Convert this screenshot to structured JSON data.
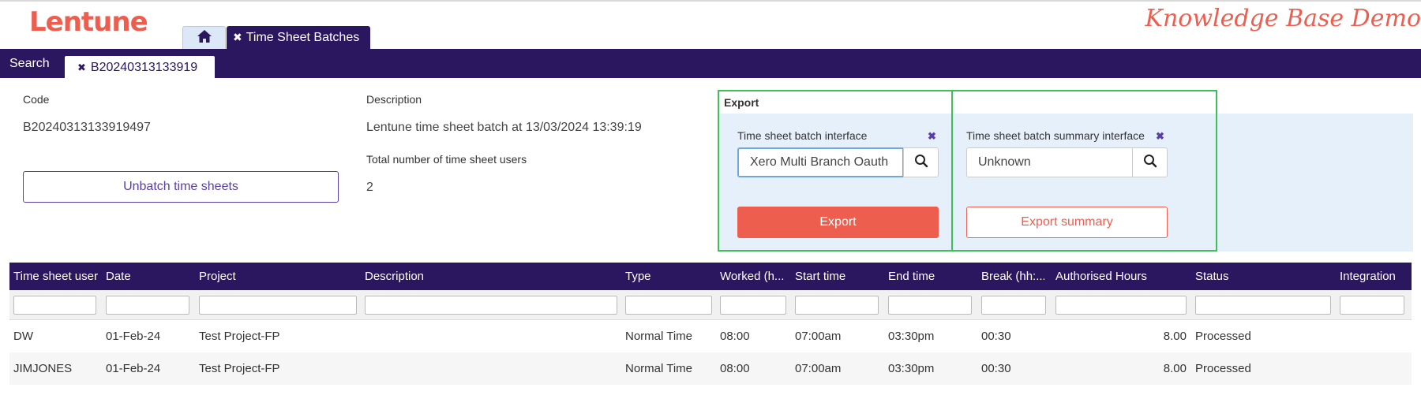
{
  "brand": {
    "logo": "Lentune",
    "right_title": "Knowledge Base Demo"
  },
  "tabs": {
    "batches_label": "Time Sheet Batches"
  },
  "subnav": {
    "search_label": "Search",
    "batch_tab_label": "B20240313133919"
  },
  "details": {
    "code_label": "Code",
    "code_value": "B20240313133919497",
    "description_label": "Description",
    "description_value": "Lentune time sheet batch at 13/03/2024 13:39:19",
    "users_label": "Total number of time sheet users",
    "users_value": "2",
    "unbatch_label": "Unbatch time sheets"
  },
  "export": {
    "title": "Export",
    "interface_label": "Time sheet batch interface",
    "interface_value": "Xero Multi Branch Oauth",
    "summary_interface_label": "Time sheet batch summary interface",
    "summary_interface_value": "Unknown",
    "export_button": "Export",
    "export_summary_button": "Export summary"
  },
  "grid": {
    "columns": [
      "Time sheet user",
      "Date",
      "Project",
      "Description",
      "Type",
      "Worked (h...",
      "Start time",
      "End time",
      "Break (hh:...",
      "Authorised Hours",
      "Status",
      "Integration"
    ],
    "rows": [
      [
        "DW",
        "01-Feb-24",
        "Test Project-FP",
        "",
        "Normal Time",
        "08:00",
        "07:00am",
        "03:30pm",
        "00:30",
        "8.00",
        "Processed",
        ""
      ],
      [
        "JIMJONES",
        "01-Feb-24",
        "Test Project-FP",
        "",
        "Normal Time",
        "08:00",
        "07:00am",
        "03:30pm",
        "00:30",
        "8.00",
        "Processed",
        ""
      ]
    ]
  },
  "colors": {
    "brand_accent": "#ee5e4f",
    "nav_purple": "#2b1760",
    "highlight_green": "#3fbf5a"
  },
  "icons": {
    "home": "home-icon",
    "close": "close-icon",
    "search": "search-icon"
  }
}
